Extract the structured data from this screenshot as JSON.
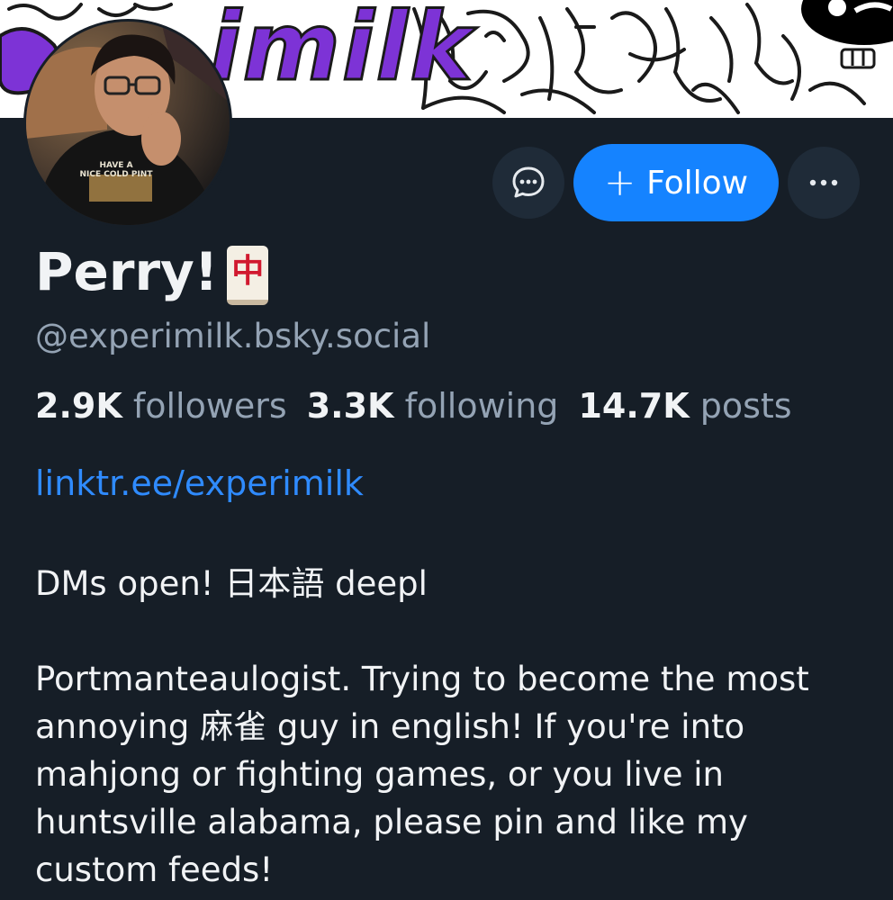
{
  "banner": {
    "text": "imilk",
    "colors": {
      "purple": "#7d33d6",
      "ink": "#1a1a1a",
      "paper": "#ffffff"
    }
  },
  "avatar": {
    "shirt_text_line1": "HAVE A",
    "shirt_text_line2": "NICE COLD PINT"
  },
  "actions": {
    "message_icon": "chat-bubble-icon",
    "follow_plus": "+",
    "follow_label": "Follow",
    "more_icon": "ellipsis-icon"
  },
  "profile": {
    "display_name": "Perry!",
    "name_emoji": "中",
    "handle": "@experimilk.bsky.social",
    "stats": [
      {
        "count": "2.9K",
        "label": "followers"
      },
      {
        "count": "3.3K",
        "label": "following"
      },
      {
        "count": "14.7K",
        "label": "posts"
      }
    ],
    "link": "linktr.ee/experimilk",
    "bio": "DMs open! 日本語 deepl\n\nPortmanteaulogist. Trying to become the most annoying 麻雀 guy in english! If you're into mahjong or fighting games, or you live in huntsville alabama, please pin and like my custom feeds!"
  },
  "theme": {
    "background": "#161e27",
    "accent": "#1583ff",
    "link": "#2f8bff",
    "muted": "#94a3b4",
    "button_dark": "#1f2b38"
  }
}
